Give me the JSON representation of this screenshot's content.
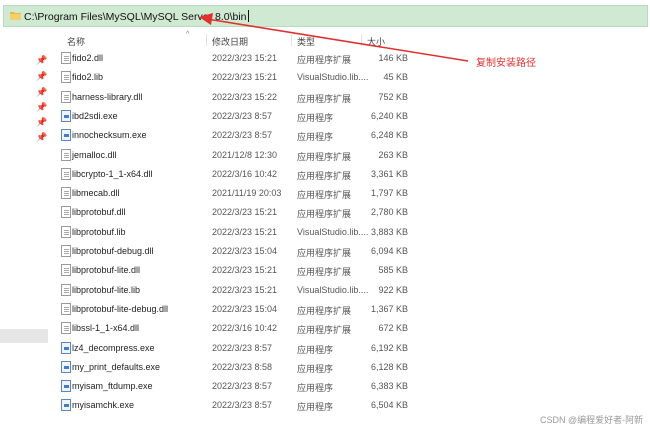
{
  "address_bar": {
    "path": "C:\\Program Files\\MySQL\\MySQL Server 8.0\\bin",
    "icon": "folder-icon"
  },
  "columns": {
    "name": "名称",
    "date": "修改日期",
    "type": "类型",
    "size": "大小"
  },
  "files": [
    {
      "name": "fido2.dll",
      "date": "2022/3/23 15:21",
      "type": "应用程序扩展",
      "size": "146 KB",
      "icon": "file"
    },
    {
      "name": "fido2.lib",
      "date": "2022/3/23 15:21",
      "type": "VisualStudio.lib....",
      "size": "45 KB",
      "icon": "file"
    },
    {
      "name": "harness-library.dll",
      "date": "2022/3/23 15:22",
      "type": "应用程序扩展",
      "size": "752 KB",
      "icon": "file"
    },
    {
      "name": "ibd2sdi.exe",
      "date": "2022/3/23 8:57",
      "type": "应用程序",
      "size": "6,240 KB",
      "icon": "exe"
    },
    {
      "name": "innochecksum.exe",
      "date": "2022/3/23 8:57",
      "type": "应用程序",
      "size": "6,248 KB",
      "icon": "exe"
    },
    {
      "name": "jemalloc.dll",
      "date": "2021/12/8 12:30",
      "type": "应用程序扩展",
      "size": "263 KB",
      "icon": "file"
    },
    {
      "name": "libcrypto-1_1-x64.dll",
      "date": "2022/3/16 10:42",
      "type": "应用程序扩展",
      "size": "3,361 KB",
      "icon": "file"
    },
    {
      "name": "libmecab.dll",
      "date": "2021/11/19 20:03",
      "type": "应用程序扩展",
      "size": "1,797 KB",
      "icon": "file"
    },
    {
      "name": "libprotobuf.dll",
      "date": "2022/3/23 15:21",
      "type": "应用程序扩展",
      "size": "2,780 KB",
      "icon": "file"
    },
    {
      "name": "libprotobuf.lib",
      "date": "2022/3/23 15:21",
      "type": "VisualStudio.lib....",
      "size": "3,883 KB",
      "icon": "file"
    },
    {
      "name": "libprotobuf-debug.dll",
      "date": "2022/3/23 15:04",
      "type": "应用程序扩展",
      "size": "6,094 KB",
      "icon": "file"
    },
    {
      "name": "libprotobuf-lite.dll",
      "date": "2022/3/23 15:21",
      "type": "应用程序扩展",
      "size": "585 KB",
      "icon": "file"
    },
    {
      "name": "libprotobuf-lite.lib",
      "date": "2022/3/23 15:21",
      "type": "VisualStudio.lib....",
      "size": "922 KB",
      "icon": "file"
    },
    {
      "name": "libprotobuf-lite-debug.dll",
      "date": "2022/3/23 15:04",
      "type": "应用程序扩展",
      "size": "1,367 KB",
      "icon": "file"
    },
    {
      "name": "libssl-1_1-x64.dll",
      "date": "2022/3/16 10:42",
      "type": "应用程序扩展",
      "size": "672 KB",
      "icon": "file"
    },
    {
      "name": "lz4_decompress.exe",
      "date": "2022/3/23 8:57",
      "type": "应用程序",
      "size": "6,192 KB",
      "icon": "exe"
    },
    {
      "name": "my_print_defaults.exe",
      "date": "2022/3/23 8:58",
      "type": "应用程序",
      "size": "6,128 KB",
      "icon": "exe"
    },
    {
      "name": "myisam_ftdump.exe",
      "date": "2022/3/23 8:57",
      "type": "应用程序",
      "size": "6,383 KB",
      "icon": "exe"
    },
    {
      "name": "myisamchk.exe",
      "date": "2022/3/23 8:57",
      "type": "应用程序",
      "size": "6,504 KB",
      "icon": "exe"
    }
  ],
  "annotation": {
    "text": "复制安装路径",
    "color": "#e03030"
  },
  "watermark": "CSDN @编程爱好者-阿新",
  "colors": {
    "address_bg": "#cfe9d2",
    "annotation": "#e03030"
  }
}
